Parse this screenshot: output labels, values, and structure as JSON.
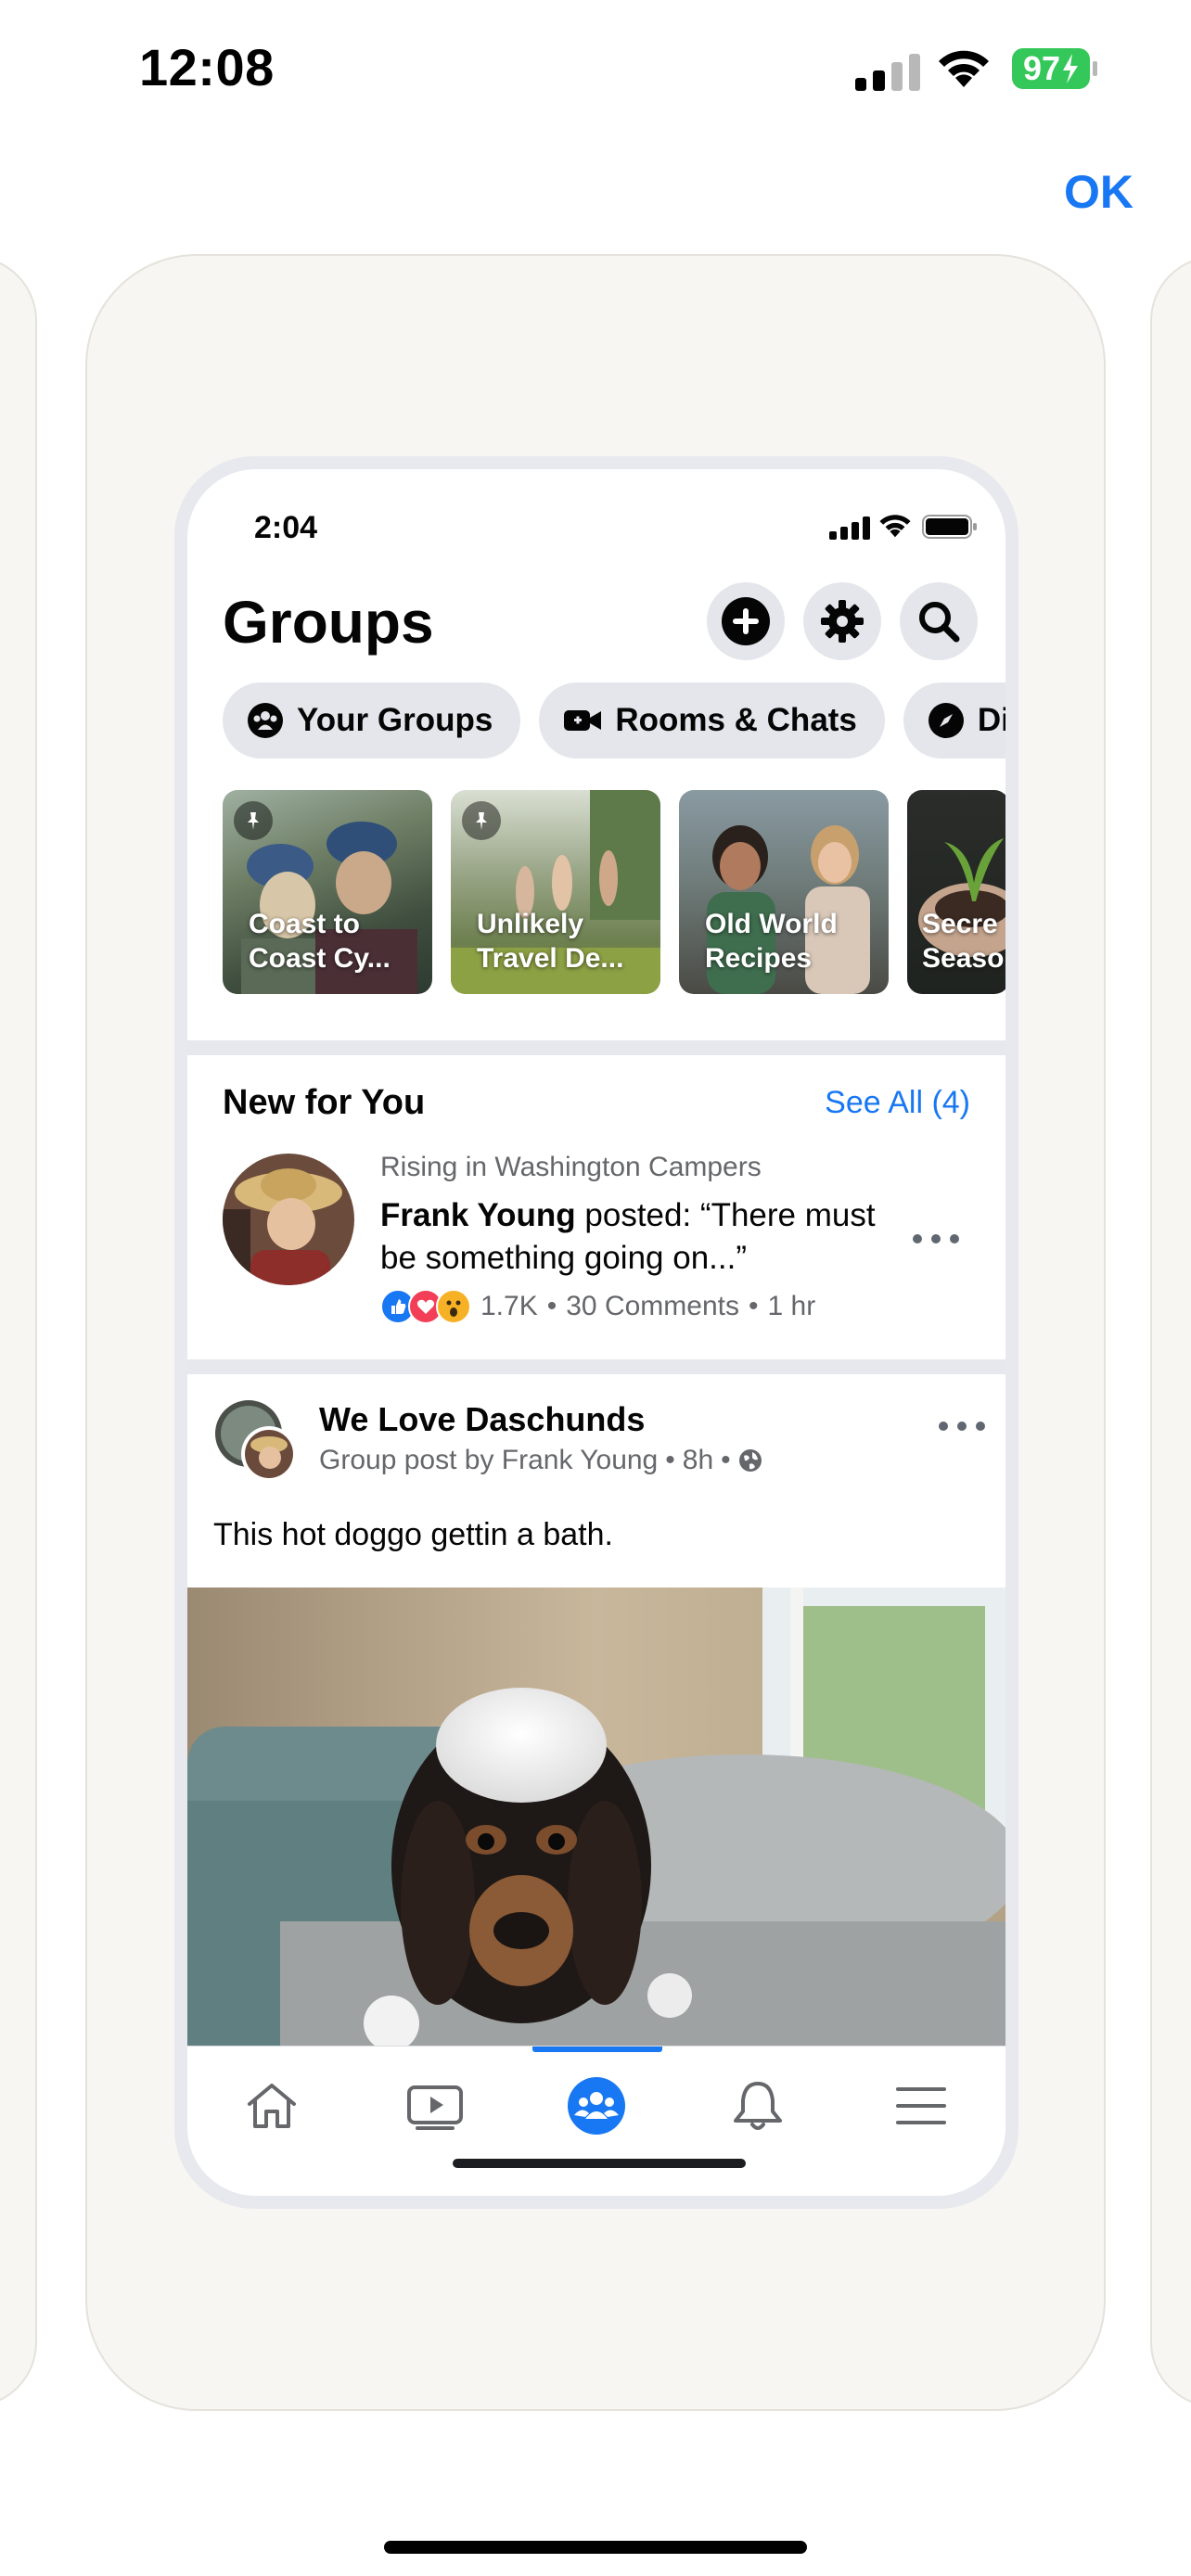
{
  "status_bar": {
    "time": "12:08",
    "battery": "97"
  },
  "header": {
    "ok_label": "OK"
  },
  "phone": {
    "status_time": "2:04",
    "title": "Groups",
    "header_icons": [
      "add-icon",
      "settings-gear-icon",
      "search-icon"
    ],
    "pills": [
      {
        "label": "Your Groups",
        "icon": "groups-icon"
      },
      {
        "label": "Rooms & Chats",
        "icon": "video-camera-icon"
      },
      {
        "label": "Dis",
        "icon": "compass-icon"
      }
    ],
    "tiles": [
      {
        "label": "Coast to Coast Cy...",
        "pinned": true
      },
      {
        "label": "Unlikely Travel De...",
        "pinned": true
      },
      {
        "label": "Old World Recipes",
        "pinned": false
      },
      {
        "label": "Secre Seaso",
        "pinned": false
      }
    ],
    "new_for_you": {
      "title": "New for You",
      "see_all": "See All (4)",
      "item": {
        "context": "Rising in Washington Campers",
        "author": "Frank Young",
        "text": " posted: “There must be something going on...”",
        "reactions_count": "1.7K",
        "comments": "30 Comments",
        "time": "1 hr"
      }
    },
    "post": {
      "group_name": "We Love Daschunds",
      "subtitle": "Group post by Frank Young",
      "time": "8h",
      "text": "This hot doggo gettin a bath."
    },
    "tabs": [
      "home-icon",
      "watch-video-icon",
      "groups-icon",
      "notifications-bell-icon",
      "menu-icon"
    ],
    "active_tab": 2
  },
  "colors": {
    "accent": "#1877f2",
    "card_bg": "#f7f6f2",
    "pill_bg": "#e4e6eb"
  }
}
